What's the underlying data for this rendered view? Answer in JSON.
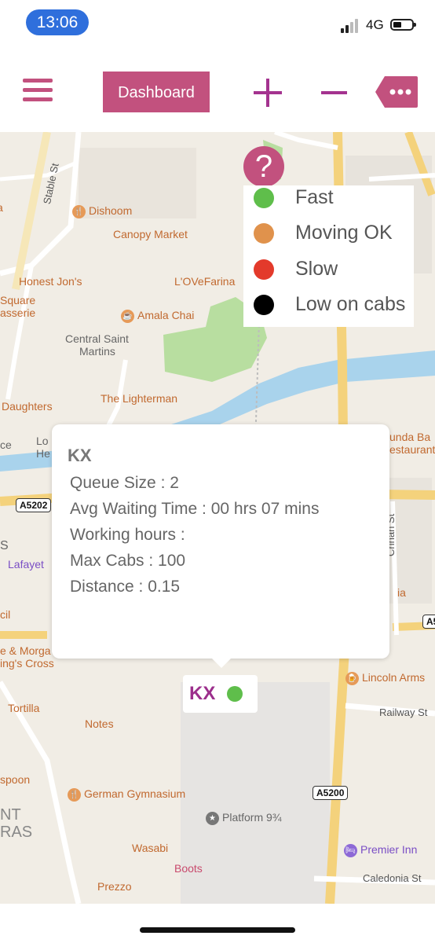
{
  "status_bar": {
    "time": "13:06",
    "network": "4G"
  },
  "toolbar": {
    "dashboard_label": "Dashboard"
  },
  "help": {
    "label": "?"
  },
  "legend": [
    {
      "label": "Fast",
      "color": "#5fbe4b"
    },
    {
      "label": "Moving OK",
      "color": "#e0924c"
    },
    {
      "label": "Slow",
      "color": "#e33a2b"
    },
    {
      "label": "Low on cabs",
      "color": "#000000"
    }
  ],
  "popup": {
    "title": "KX",
    "queue_size": "Queue Size : 2",
    "avg_wait": "Avg Waiting Time : 00 hrs 07 mins",
    "working_hours": "Working hours :",
    "max_cabs": "Max Cabs : 100",
    "distance": "Distance : 0.15"
  },
  "marker": {
    "label": "KX",
    "status_color": "#5fbe4b"
  },
  "map": {
    "places": {
      "dishoom": "Dishoom",
      "canopy_market": "Canopy Market",
      "honest_jons": "Honest Jon's",
      "lovefarina": "L'OVeFarina",
      "square_asserie_1": "Square",
      "square_asserie_2": "asserie",
      "amala_chai": "Amala Chai",
      "central_saint_martins_1": "Central Saint",
      "central_saint_martins_2": "Martins",
      "daughters": "Daughters",
      "the_lighterman": "The Lighterman",
      "ce": "ce",
      "lo_he_1": "Lo",
      "lo_he_2": "He",
      "munda_1": "unda Ba",
      "munda_2": "estaurant",
      "s_frag": "S",
      "lafayette": "Lafayet",
      "cil": "cil",
      "e_morgan_1": "e & Morga",
      "e_morgan_2": "ing's Cross",
      "tortilla": "Tortilla",
      "notes": "Notes",
      "lincoln_arms": "Lincoln Arms",
      "spoon": "spoon",
      "german_gymnasium": "German Gymnasium",
      "platform": "Platform 9¾",
      "wasabi": "Wasabi",
      "boots": "Boots",
      "prezzo": "Prezzo",
      "premier_inn": "Premier Inn",
      "nt": "NT",
      "ras": "RAS",
      "a_frag": "a",
      "ia_frag": "ia"
    },
    "streets": {
      "stable_st": "Stable St",
      "crinan_st": "Crinan St",
      "railway_st": "Railway St",
      "caledonia_st": "Caledonia St"
    },
    "road_shields": {
      "a5202": "A5202",
      "a5200": "A5200",
      "a5_frag": "A5"
    }
  }
}
